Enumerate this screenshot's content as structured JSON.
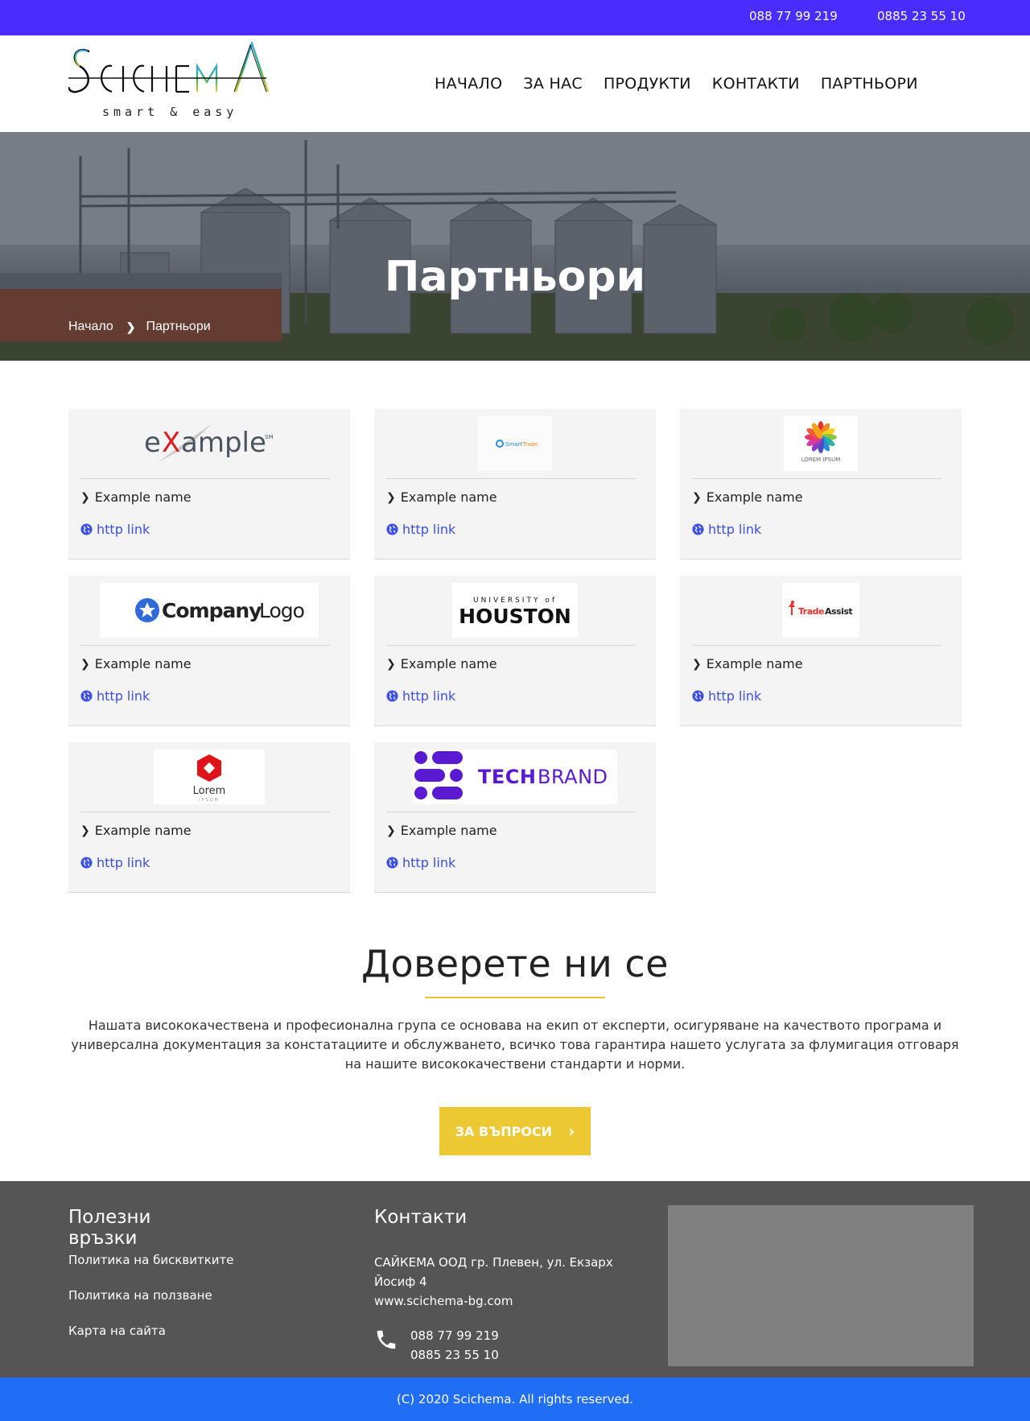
{
  "topbar": {
    "phone1": "088 77 99 219",
    "phone2": "0885 23 55 10",
    "color": "#4a2cff"
  },
  "logo": {
    "name": "SCICHEMA",
    "tagline": "smart & easy"
  },
  "nav": [
    {
      "label": "НАЧАЛО"
    },
    {
      "label": "ЗА НАС"
    },
    {
      "label": "ПРОДУКТИ"
    },
    {
      "label": "КОНТАКТИ"
    },
    {
      "label": "ПАРТНЬОРИ"
    }
  ],
  "hero": {
    "title": "Партньори"
  },
  "breadcrumb": {
    "home": "Начало",
    "current": "Партньори"
  },
  "partners": [
    {
      "logo": "example-logo",
      "logo_text": "eXample",
      "name": "Example name",
      "link": "http link"
    },
    {
      "logo": "smarttrade-logo",
      "logo_text": "SmartTrade",
      "name": "Example name",
      "link": "http link"
    },
    {
      "logo": "lorem-ipsum-flower-logo",
      "logo_text": "LOREM IPSUM",
      "name": "Example name",
      "link": "http link"
    },
    {
      "logo": "companylogo-logo",
      "logo_text": "CompanyLogo",
      "name": "Example name",
      "link": "http link"
    },
    {
      "logo": "university-houston-logo",
      "logo_text": "UNIVERSITY of HOUSTON",
      "name": "Example name",
      "link": "http link"
    },
    {
      "logo": "tradeassist-logo",
      "logo_text": "TradeAssist",
      "name": "Example name",
      "link": "http link"
    },
    {
      "logo": "lorem-ipsum-red-logo",
      "logo_text": "Lorem IPSUM",
      "name": "Example name",
      "link": "http link"
    },
    {
      "logo": "techbrand-logo",
      "logo_text": "TECHBRAND",
      "name": "Example name",
      "link": "http link"
    }
  ],
  "trust": {
    "title": "Доверете ни се",
    "text": "Нашата висококачествена и професионална група се основава на екип от експерти, осигуряване на качеството програма и универсална документация за констатациите и обслужването, всичко това гарантира нашето услугата за флумигация отговаря на нашите висококачествени стандарти и норми.",
    "button": "ЗА ВЪПРОСИ",
    "accent": "#ecc832"
  },
  "footer": {
    "links_title": "Полезни връзки",
    "links": [
      "Политика на бисквитките",
      "Политика на ползване",
      "Карта на сайта"
    ],
    "contacts_title": "Контакти",
    "address": "САЙКЕМА ООД гр. Плевен, ул. Екзарх Йосиф 4",
    "website": "www.scichema-bg.com",
    "phone1": "088 77 99 219",
    "phone2": "0885 23 55 10",
    "copyright": "(C) 2020 Scichema. All rights reserved.",
    "copyright_color": "#1f6ef5"
  }
}
